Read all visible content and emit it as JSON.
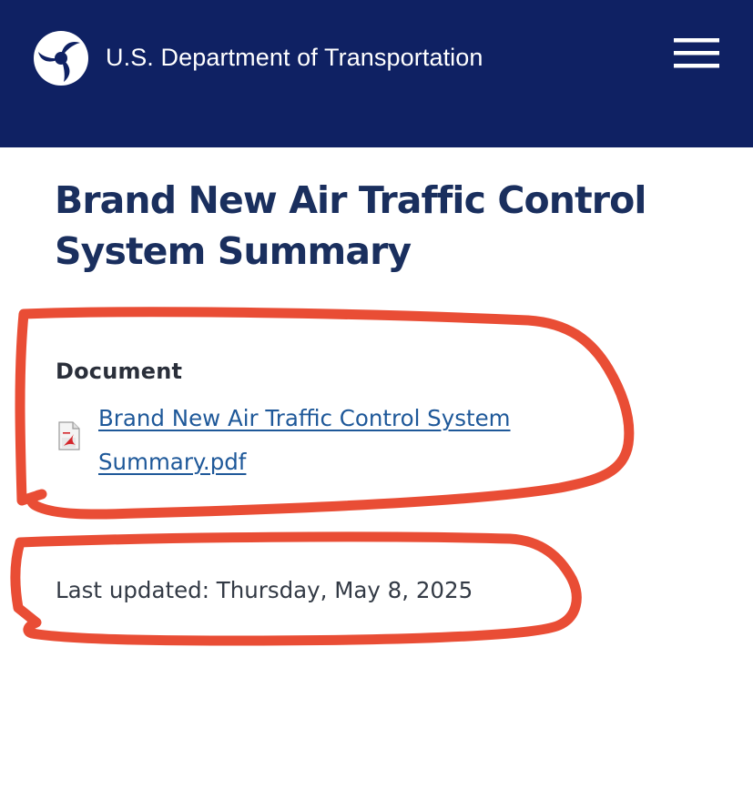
{
  "header": {
    "agency_name": "U.S. Department of Transportation",
    "logo_icon": "dot-tri-swirl-logo",
    "menu_icon": "hamburger-menu-icon",
    "background_color": "#0f2163"
  },
  "main": {
    "title": "Brand New Air Traffic Control System Summary",
    "document_section": {
      "label": "Document",
      "file_icon": "pdf-file-icon",
      "link_text": "Brand New Air Traffic Control System Summary.pdf",
      "link_color": "#1e5899"
    },
    "last_updated": "Last updated: Thursday, May 8, 2025"
  },
  "annotations": {
    "marker_color": "#e8432a",
    "marks": [
      "red-circle-document",
      "red-circle-last-updated"
    ]
  }
}
